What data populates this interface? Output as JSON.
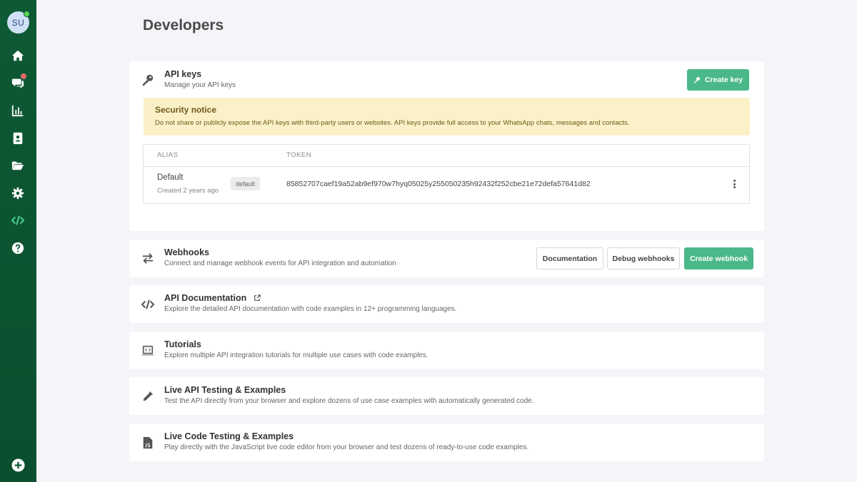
{
  "sidebar": {
    "avatar_initials": "SU",
    "items": [
      {
        "name": "home-icon"
      },
      {
        "name": "chat-icon"
      },
      {
        "name": "chart-icon"
      },
      {
        "name": "contacts-icon"
      },
      {
        "name": "folder-icon"
      },
      {
        "name": "gear-icon"
      },
      {
        "name": "code-icon"
      },
      {
        "name": "help-icon"
      }
    ],
    "bottom_action": "plus-circle-icon"
  },
  "page": {
    "title": "Developers"
  },
  "api_keys": {
    "title": "API keys",
    "subtitle": "Manage your API keys",
    "create_label": "Create key",
    "notice_title": "Security notice",
    "notice_text": "Do not share or publicly expose the API keys with third-party users or websites. API keys provide full access to your WhatsApp chats, messages and contacts.",
    "columns": [
      "ALIAS",
      "TOKEN"
    ],
    "rows": [
      {
        "alias": "Default",
        "created": "Created 2 years ago",
        "tag": "default",
        "token": "85852707caef19a52ab9ef970w7hyq05025y255050235h92432f252cbe21e72defa57641d82"
      }
    ]
  },
  "webhooks": {
    "title": "Webhooks",
    "subtitle": "Connect and manage webhook events for API integration and automation",
    "docs_label": "Documentation",
    "debug_label": "Debug webhooks",
    "create_label": "Create webhook"
  },
  "api_docs": {
    "title": "API Documentation",
    "subtitle": "Explore the detailed API documentation with code examples in 12+ programming languages."
  },
  "tutorials": {
    "title": "Tutorials",
    "subtitle": "Explore multiple API integration tutorials for multiple use cases with code examples."
  },
  "live_api": {
    "title": "Live API Testing & Examples",
    "subtitle": "Test the API directly from your browser and explore dozens of use case examples with automatically generated code."
  },
  "live_code": {
    "title": "Live Code Testing & Examples",
    "subtitle": "Play directly with the JavaScript live code editor from your browser and test dozens of ready-to-use code examples."
  },
  "colors": {
    "sidebar": "#0d5a34",
    "accent": "#4bb88a",
    "notice_bg": "#fbf1c8"
  }
}
